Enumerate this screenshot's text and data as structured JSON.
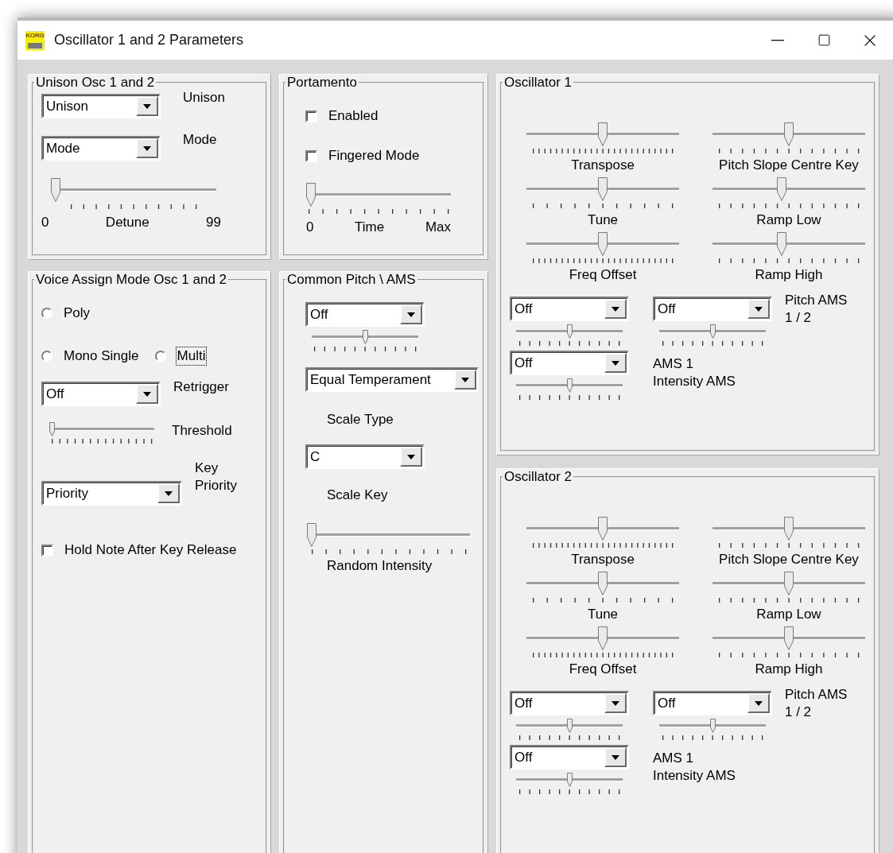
{
  "window": {
    "title": "Oscillator 1 and 2 Parameters",
    "logo_text": "KORG"
  },
  "unison": {
    "title": "Unison Osc 1 and 2",
    "dropdowns": [
      {
        "value": "Unison",
        "label": "Unison"
      },
      {
        "value": "Mode",
        "label": "Mode"
      }
    ],
    "detune": {
      "level": 0,
      "min": "0",
      "label": "Detune",
      "max": "99"
    }
  },
  "portamento": {
    "title": "Portamento",
    "checkboxes": [
      {
        "label": "Enabled",
        "checked": false
      },
      {
        "label": "Fingered Mode",
        "checked": false
      }
    ],
    "time": {
      "level": 0,
      "min": "0",
      "label": "Time",
      "max": "Max"
    }
  },
  "voice_assign": {
    "title": "Voice Assign Mode Osc 1 and 2",
    "radios": [
      {
        "label": "Poly",
        "selected": false,
        "focused": false
      },
      {
        "label": "Mono Single",
        "selected": false,
        "focused": false
      },
      {
        "label": "Multi",
        "selected": false,
        "focused": true
      }
    ],
    "retrigger": {
      "value": "Off",
      "label": "Retrigger"
    },
    "threshold": {
      "level": 0,
      "label": "Threshold"
    },
    "key_priority": {
      "value": "Priority",
      "label": "Key\nPriority"
    },
    "hold": {
      "label": "Hold Note After Key Release",
      "checked": false
    }
  },
  "common_pitch": {
    "title": "Common Pitch \\ AMS",
    "ams": {
      "value": "Off",
      "level": 0.5
    },
    "scale_type": {
      "value": "Equal Temperament",
      "label": "Scale Type"
    },
    "scale_key": {
      "value": "C",
      "label": "Scale Key"
    },
    "random_intensity": {
      "level": 0,
      "label": "Random Intensity"
    }
  },
  "oscillators": [
    {
      "title": "Oscillator 1",
      "sliders": [
        {
          "label": "Transpose",
          "level": 0.5
        },
        {
          "label": "Pitch Slope Centre Key",
          "level": 0.5
        },
        {
          "label": "Tune",
          "level": 0.5
        },
        {
          "label": "Ramp Low",
          "level": 0.45
        },
        {
          "label": "Freq Offset",
          "level": 0.5
        },
        {
          "label": "Ramp High",
          "level": 0.45
        }
      ],
      "pitch_ams": {
        "dropdowns": [
          {
            "value": "Off",
            "level": 0.5
          },
          {
            "value": "Off",
            "level": 0.5
          }
        ],
        "label": "Pitch AMS\n1 / 2"
      },
      "intensity": {
        "value": "Off",
        "level": 0.5,
        "label": "AMS 1\nIntensity AMS"
      }
    },
    {
      "title": "Oscillator 2",
      "sliders": [
        {
          "label": "Transpose",
          "level": 0.5
        },
        {
          "label": "Pitch Slope Centre Key",
          "level": 0.5
        },
        {
          "label": "Tune",
          "level": 0.5
        },
        {
          "label": "Ramp Low",
          "level": 0.5
        },
        {
          "label": "Freq Offset",
          "level": 0.5
        },
        {
          "label": "Ramp High",
          "level": 0.5
        }
      ],
      "pitch_ams": {
        "dropdowns": [
          {
            "value": "Off",
            "level": 0.5
          },
          {
            "value": "Off",
            "level": 0.5
          }
        ],
        "label": "Pitch AMS\n1 / 2"
      },
      "intensity": {
        "value": "Off",
        "level": 0.5,
        "label": "AMS 1\nIntensity AMS"
      }
    }
  ]
}
